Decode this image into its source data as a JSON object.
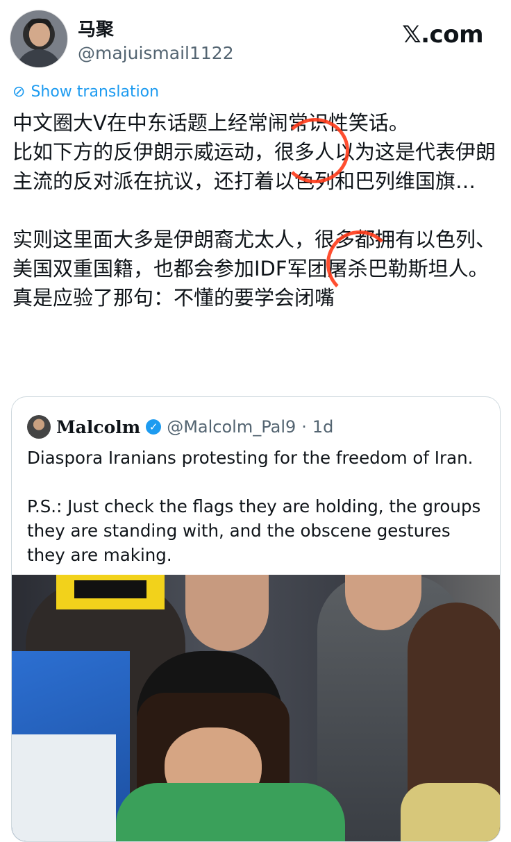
{
  "header": {
    "display_name": "马聚",
    "handle": "@majuismail1122",
    "site_logo": "𝕏.com"
  },
  "translation": {
    "label": "Show translation",
    "icon": "translate-globe-icon"
  },
  "tweet": {
    "text": "中文圈大V在中东话题上经常闹常识性笑话。\n比如下方的反伊朗示威运动，很多人以为这是代表伊朗主流的反对派在抗议，还打着以色列和巴列维国旗…\n\n实则这里面大多是伊朗裔尤太人，很多都拥有以色列、美国双重国籍，也都会参加IDF军团屠杀巴勒斯坦人。\n真是应验了那句：不懂的要学会闭嘴"
  },
  "quoted_tweet": {
    "name": "Malcolm",
    "verified_icon": "verified-badge-icon",
    "handle": "@Malcolm_Pal9",
    "separator": "·",
    "time": "1d",
    "text": "Diaspora Iranians protesting for the freedom of Iran.\n\nP.S.: Just check the flags they are holding, the groups they are standing with, and the obscene gestures they are making."
  },
  "colors": {
    "link": "#1d9bf0",
    "muted": "#536471",
    "annotation": "#ff3b1a"
  }
}
